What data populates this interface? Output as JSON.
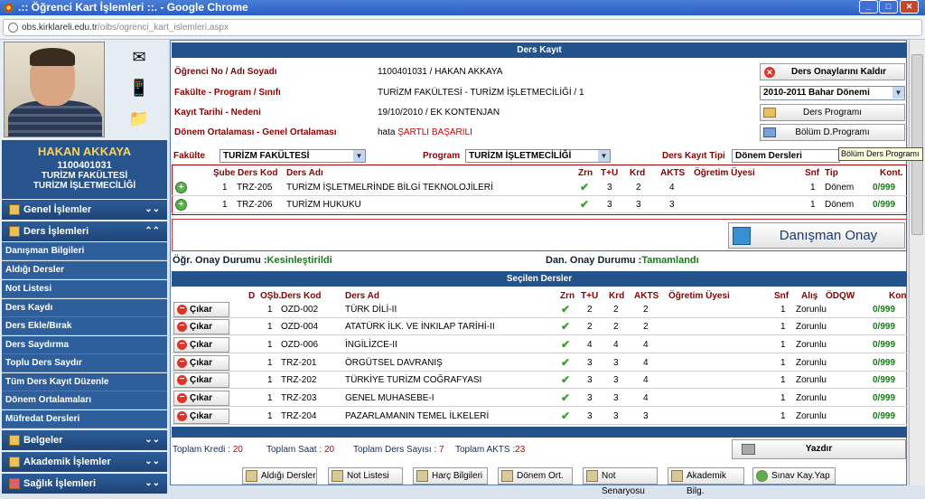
{
  "window": {
    "title": ".:: Öğrenci Kart İşlemleri ::. - Google Chrome",
    "url_host": "obs.kirklareli.edu.tr",
    "url_path": "/oibs/ogrenci_kart_islemleri.aspx"
  },
  "student": {
    "name": "HAKAN AKKAYA",
    "number": "1100401031",
    "faculty": "TURİZM FAKÜLTESİ",
    "program": "TURİZM İŞLETMECİLİĞİ"
  },
  "menu": {
    "genel": "Genel İşlemler",
    "ders": "Ders İşlemleri",
    "items": [
      "Danışman Bilgileri",
      "Aldığı Dersler",
      "Not Listesi",
      "Ders Kaydı",
      "Ders Ekle/Bırak",
      "Ders Saydırma",
      "Toplu Ders Saydır",
      "Tüm Ders Kayıt Düzenle",
      "Dönem Ortalamaları",
      "Müfredat Dersleri"
    ],
    "belgeler": "Belgeler",
    "akademik": "Akademik İşlemler",
    "saglik": "Sağlık İşlemleri"
  },
  "kayit": {
    "header": "Ders Kayıt",
    "labels": [
      "Öğrenci No / Adı Soyadı",
      "Fakülte - Program / Sınıfı",
      "Kayıt Tarihi - Nedeni",
      "Dönem Ortalaması - Genel Ortalaması"
    ],
    "values": [
      "1100401031 / HAKAN AKKAYA",
      "TURİZM FAKÜLTESİ - TURİZM İŞLETMECİLİĞİ / 1",
      "19/10/2010 / EK KONTENJAN",
      "hata"
    ],
    "status_red": "ŞARTLI BAŞARILI",
    "remove_button": "Ders Onaylarını Kaldır",
    "term": "2010-2011 Bahar Dönemi",
    "program_button": "Ders Programı",
    "bolum_button": "Bölüm D.Programı",
    "tooltip": "Bölüm Ders Programı"
  },
  "filters": {
    "fakulte_label": "Fakülte",
    "fakulte": "TURİZM FAKÜLTESİ",
    "program_label": "Program",
    "program": "TURİZM İŞLETMECİLİĞİ",
    "tip_label": "Ders Kayıt Tipi",
    "tip": "Dönem Dersleri"
  },
  "available": {
    "headers": [
      "Şube",
      "Ders Kod",
      "Ders Adı",
      "Zrn",
      "T+U",
      "Krd",
      "AKTS",
      "Öğretim Üyesi",
      "Snf",
      "Tip",
      "Kont."
    ],
    "rows": [
      {
        "sube": "1",
        "kod": "TRZ-205",
        "ad": "TURİZM İŞLETMELRİNDE BİLGİ TEKNOLOJİLERİ",
        "tu": "3",
        "krd": "2",
        "akts": "4",
        "snf": "1",
        "tip": "Dönem",
        "kont": "0/999"
      },
      {
        "sube": "1",
        "kod": "TRZ-206",
        "ad": "TURİZM HUKUKU",
        "tu": "3",
        "krd": "3",
        "akts": "3",
        "snf": "1",
        "tip": "Dönem",
        "kont": "0/999"
      }
    ]
  },
  "approve": {
    "button": "Danışman Onay",
    "ogr_label": "Öğr. Onay Durumu :",
    "ogr_value": "Kesinleştirildi",
    "dan_label": "Dan. Onay Durumu :",
    "dan_value": "Tamamlandı"
  },
  "selected": {
    "header": "Seçilen Dersler",
    "headers": [
      "D",
      "OŞb.",
      "Ders Kod",
      "Ders Ad",
      "Zrn",
      "T+U",
      "Krd",
      "AKTS",
      "Öğretim Üyesi",
      "Snf",
      "Alış",
      "ÖDQW",
      "Kon"
    ],
    "remove_label": "Çıkar",
    "rows": [
      {
        "osb": "1",
        "kod": "OZD-002",
        "ad": "TÜRK DİLİ-II",
        "tu": "2",
        "krd": "2",
        "akts": "2",
        "snf": "1",
        "alis": "Zorunlu",
        "kon": "0/999"
      },
      {
        "osb": "1",
        "kod": "OZD-004",
        "ad": "ATATÜRK İLK. VE İNKILAP TARİHİ-II",
        "tu": "2",
        "krd": "2",
        "akts": "2",
        "snf": "1",
        "alis": "Zorunlu",
        "kon": "0/999"
      },
      {
        "osb": "1",
        "kod": "OZD-006",
        "ad": "İNGİLİZCE-II",
        "tu": "4",
        "krd": "4",
        "akts": "4",
        "snf": "1",
        "alis": "Zorunlu",
        "kon": "0/999"
      },
      {
        "osb": "1",
        "kod": "TRZ-201",
        "ad": "ÖRGÜTSEL DAVRANIŞ",
        "tu": "3",
        "krd": "3",
        "akts": "4",
        "snf": "1",
        "alis": "Zorunlu",
        "kon": "0/999"
      },
      {
        "osb": "1",
        "kod": "TRZ-202",
        "ad": "TÜRKİYE TURİZM COĞRAFYASI",
        "tu": "3",
        "krd": "3",
        "akts": "4",
        "snf": "1",
        "alis": "Zorunlu",
        "kon": "0/999"
      },
      {
        "osb": "1",
        "kod": "TRZ-203",
        "ad": "GENEL MUHASEBE-I",
        "tu": "3",
        "krd": "3",
        "akts": "4",
        "snf": "1",
        "alis": "Zorunlu",
        "kon": "0/999"
      },
      {
        "osb": "1",
        "kod": "TRZ-204",
        "ad": "PAZARLAMANIN TEMEL İLKELERİ",
        "tu": "3",
        "krd": "3",
        "akts": "3",
        "snf": "1",
        "alis": "Zorunlu",
        "kon": "0/999"
      }
    ]
  },
  "totals": {
    "kredi_label": "Toplam Kredi :",
    "kredi": "20",
    "saat_label": "Toplam Saat :",
    "saat": "20",
    "sayi_label": "Toplam Ders Sayısı :",
    "sayi": "7",
    "akts_label": "Toplam AKTS :",
    "akts": "23"
  },
  "print_label": "Yazdır",
  "bottom_buttons": [
    "Aldığı Dersler",
    "Not Listesi",
    "Harç Bilgileri",
    "Dönem Ort.",
    "Not Senaryosu",
    "Akademik Bilg.",
    "Sınav Kay.Yap"
  ],
  "icons": {
    "check": "check-icon",
    "plus": "plus-icon",
    "minus": "minus-icon"
  },
  "colors": {
    "header_blue": "#24538c",
    "label_red": "#8b0000",
    "value_red": "#cc0000",
    "green": "#1a7a1a"
  }
}
